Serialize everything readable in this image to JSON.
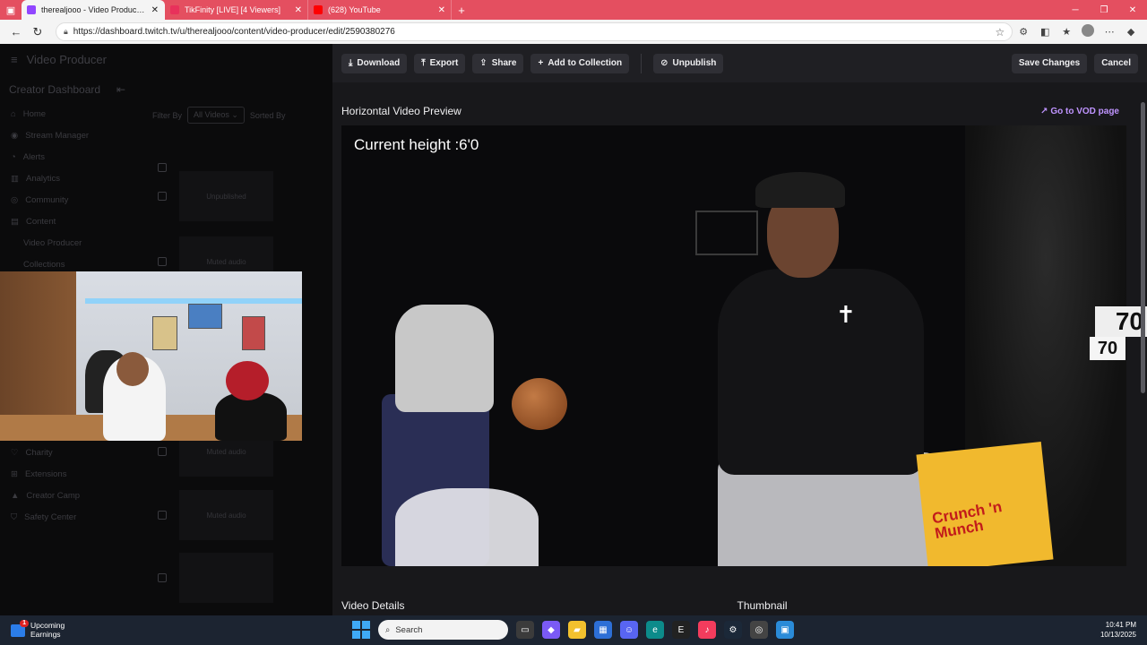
{
  "browser": {
    "tabs": [
      {
        "title": "therealjooo - Video Producer - Tw",
        "active": true,
        "color": "#9146ff"
      },
      {
        "title": "TikFinity [LIVE] [4 Viewers]",
        "active": false,
        "color": "#e8315b"
      },
      {
        "title": "(628) YouTube",
        "active": false,
        "color": "#ff0000"
      }
    ],
    "url": "https://dashboard.twitch.tv/u/therealjooo/content/video-producer/edit/2590380276"
  },
  "dashboard": {
    "header": "Video Producer",
    "section": "Creator Dashboard",
    "nav": [
      "Home",
      "Stream Manager",
      "Alerts",
      "Analytics",
      "Community",
      "Content"
    ],
    "subnav": [
      "Video Producer",
      "Collections"
    ],
    "nav_bottom": [
      "Charity",
      "Extensions",
      "Creator Camp",
      "Safety Center"
    ],
    "filter_label": "Filter By",
    "filter_value": "All Videos",
    "sort_label": "Sorted By",
    "unpublished": "Unpublished",
    "muted_audio": "Muted audio"
  },
  "toolbar": {
    "download": "Download",
    "export": "Export",
    "share": "Share",
    "add_collection": "Add to Collection",
    "unpublish": "Unpublish",
    "save": "Save Changes",
    "cancel": "Cancel"
  },
  "preview": {
    "title": "Horizontal Video Preview",
    "vod_link": "Go to VOD page",
    "caption": "Current height :6'0",
    "counter_top": "70",
    "counter_bottom": "70",
    "box_text": "Crunch 'n Munch"
  },
  "sections": {
    "details": "Video Details",
    "thumbnail": "Thumbnail"
  },
  "taskbar": {
    "widget_title": "Upcoming",
    "widget_sub": "Earnings",
    "widget_badge": "1",
    "search_placeholder": "Search",
    "time": "10:41 PM",
    "date": "10/13/2025"
  }
}
